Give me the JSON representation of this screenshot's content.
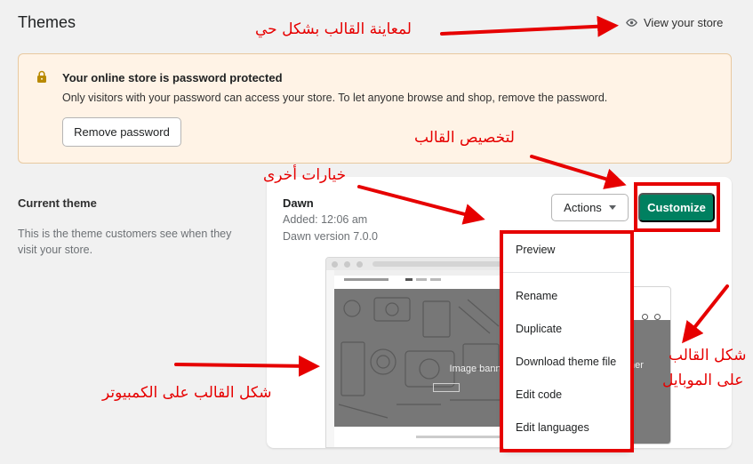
{
  "header": {
    "title": "Themes",
    "view_store": "View your store"
  },
  "banner": {
    "title": "Your online store is password protected",
    "text": "Only visitors with your password can access your store. To let anyone browse and shop, remove the password.",
    "remove_button": "Remove password"
  },
  "current_theme": {
    "title": "Current theme",
    "description": "This is the theme customers see when they visit your store."
  },
  "theme": {
    "name": "Dawn",
    "added": "Added: 12:06 am",
    "version": "Dawn version 7.0.0",
    "actions_button": "Actions",
    "customize_button": "Customize"
  },
  "preview": {
    "desktop_banner_label": "Image banner",
    "mobile_banner_label": "ner"
  },
  "dropdown": {
    "items": [
      "Preview",
      "Rename",
      "Duplicate",
      "Download theme file",
      "Edit code",
      "Edit languages"
    ]
  },
  "annotations": {
    "view_store": "لمعاينة القالب بشكل حي",
    "customize": "لتخصيص القالب",
    "other_options": "خيارات أخرى",
    "desktop_shape": "شكل القالب على الكمبيوتر",
    "mobile_shape_line1": "شكل القالب",
    "mobile_shape_line2": "على الموبايل"
  },
  "colors": {
    "primary": "#008060",
    "annotation": "#e60000",
    "banner_bg": "#fff3e6"
  }
}
